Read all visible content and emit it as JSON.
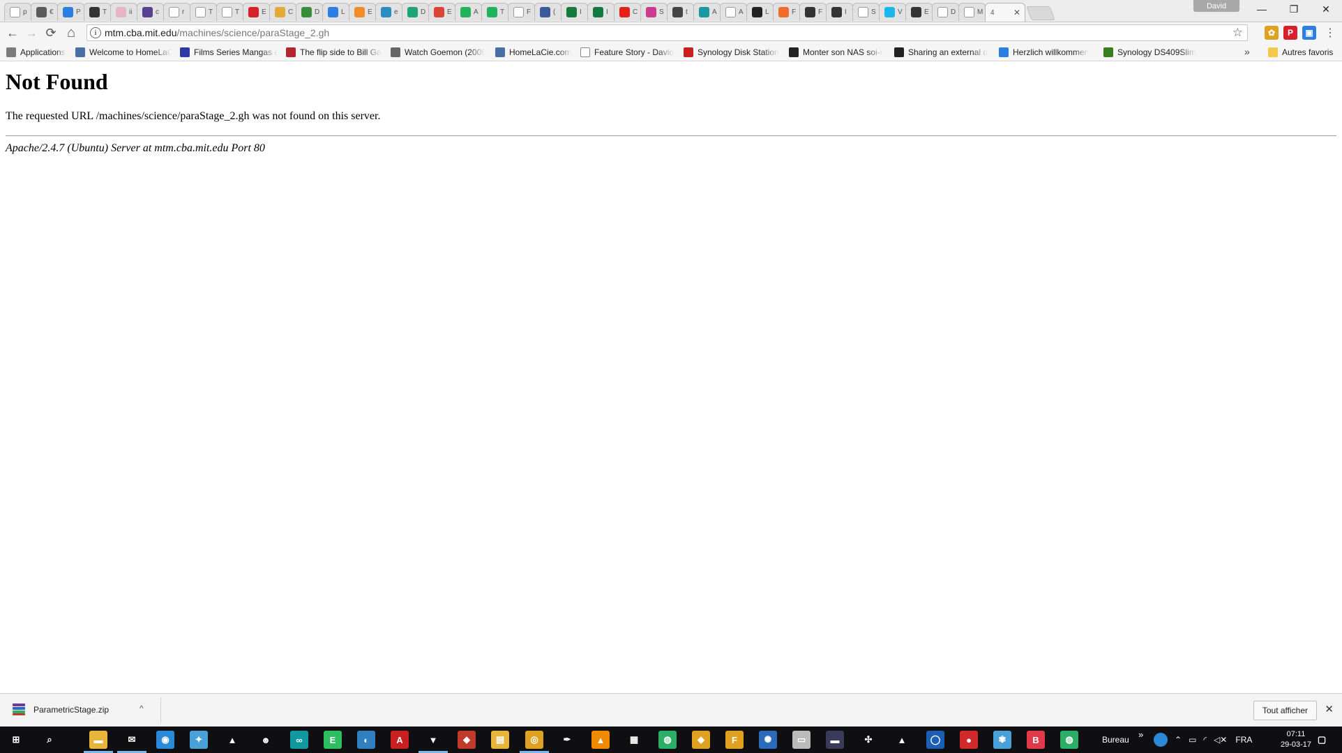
{
  "window": {
    "profile_name": "David",
    "controls": {
      "minimize": "—",
      "maximize": "❐",
      "close": "✕"
    }
  },
  "tabs": [
    {
      "icon": "google-icon",
      "letter": "p",
      "color": "#ffffff"
    },
    {
      "icon": "slack-icon",
      "letter": "€",
      "color": "#5b5b5b"
    },
    {
      "icon": "dropbox-icon",
      "letter": "P",
      "color": "#2b7fe0"
    },
    {
      "icon": "pin-icon",
      "letter": "T",
      "color": "#333333"
    },
    {
      "icon": "heart-icon",
      "letter": "ii",
      "color": "#e5b6c6"
    },
    {
      "icon": "grid-icon",
      "letter": "c",
      "color": "#5a3f8f"
    },
    {
      "icon": "google-icon",
      "letter": "r",
      "color": "#ffffff"
    },
    {
      "icon": "page-icon",
      "letter": "T",
      "color": "#ffffff"
    },
    {
      "icon": "page-icon",
      "letter": "T",
      "color": "#ffffff"
    },
    {
      "icon": "pinterest-icon",
      "letter": "E",
      "color": "#d6202a"
    },
    {
      "icon": "hands-icon",
      "letter": "C",
      "color": "#e5a93a"
    },
    {
      "icon": "shield-icon",
      "letter": "D",
      "color": "#3a8d3a"
    },
    {
      "icon": "globe-icon",
      "letter": "L",
      "color": "#2b7fe0"
    },
    {
      "icon": "bg-icon",
      "letter": "E",
      "color": "#f28c28"
    },
    {
      "icon": "wordpress-icon",
      "letter": "e",
      "color": "#2b8cc4"
    },
    {
      "icon": "drop-icon",
      "letter": "D",
      "color": "#1fa37a"
    },
    {
      "icon": "gmail-icon",
      "letter": "E",
      "color": "#db4437"
    },
    {
      "icon": "m-icon",
      "letter": "A",
      "color": "#20b25c"
    },
    {
      "icon": "m-icon",
      "letter": "T",
      "color": "#20b25c"
    },
    {
      "icon": "google-icon",
      "letter": "F",
      "color": "#ffffff"
    },
    {
      "icon": "facebook-icon",
      "letter": "(",
      "color": "#3b5998"
    },
    {
      "icon": "k-icon",
      "letter": "I",
      "color": "#157a3d"
    },
    {
      "icon": "k-icon",
      "letter": "I",
      "color": "#157a3d"
    },
    {
      "icon": "youtube-icon",
      "letter": "C",
      "color": "#e62117"
    },
    {
      "icon": "5x-icon",
      "letter": "S",
      "color": "#cc3b8f"
    },
    {
      "icon": "tools-icon",
      "letter": "t",
      "color": "#444444"
    },
    {
      "icon": "infinity-icon",
      "letter": "A",
      "color": "#1a9aa0"
    },
    {
      "icon": "page-icon",
      "letter": "A",
      "color": "#ffffff"
    },
    {
      "icon": "car-icon",
      "letter": "L",
      "color": "#222222"
    },
    {
      "icon": "e-circle-icon",
      "letter": "F",
      "color": "#f06b2d"
    },
    {
      "icon": "a-icon",
      "letter": "F",
      "color": "#333333"
    },
    {
      "icon": "dark-icon",
      "letter": "I",
      "color": "#333333"
    },
    {
      "icon": "page-icon",
      "letter": "S",
      "color": "#ffffff"
    },
    {
      "icon": "vimeo-icon",
      "letter": "V",
      "color": "#1ab7ea"
    },
    {
      "icon": "pattern-icon",
      "letter": "E",
      "color": "#333333"
    },
    {
      "icon": "page-icon",
      "letter": "D",
      "color": "#ffffff"
    },
    {
      "icon": "book-icon",
      "letter": "M",
      "color": "#ffffff"
    }
  ],
  "active_tab": {
    "title": "4",
    "close": "✕"
  },
  "toolbar": {
    "back": "←",
    "forward": "→",
    "reload": "⟳",
    "home": "⌂",
    "url_host": "mtm.cba.mit.edu",
    "url_path": "/machines/science/paraStage_2.gh",
    "info": "i",
    "star": "☆"
  },
  "extensions": [
    {
      "name": "extension-icon-1",
      "glyph": "✿",
      "color": "#e0a020"
    },
    {
      "name": "pinterest-extension-icon",
      "glyph": "P",
      "color": "#d6202a"
    },
    {
      "name": "extension-icon-3",
      "glyph": "▣",
      "color": "#2b7fe0"
    }
  ],
  "menu_glyph": "⋮",
  "bookmarks": [
    {
      "label": "Applications",
      "icon": "apps-grid-icon",
      "color": "#7a7a7a"
    },
    {
      "label": "Welcome to HomeLaC",
      "icon": "feather-icon",
      "color": "#4a6fa5"
    },
    {
      "label": "Films Series Mangas e",
      "icon": "c-icon",
      "color": "#2d3aa6"
    },
    {
      "label": "The flip side to Bill Ga",
      "icon": "nhl-icon",
      "color": "#b3262e"
    },
    {
      "label": "Watch Goemon (2009",
      "icon": "truck-icon",
      "color": "#666666"
    },
    {
      "label": "HomeLaCie.com",
      "icon": "feather-icon",
      "color": "#4a6fa5"
    },
    {
      "label": "Feature Story - David",
      "icon": "page-icon",
      "color": "#ffffff"
    },
    {
      "label": "Synology Disk Station",
      "icon": "synology-icon",
      "color": "#c8201f"
    },
    {
      "label": "Monter son NAS soi-r",
      "icon": "tw-icon",
      "color": "#222222"
    },
    {
      "label": "Sharing an external d",
      "icon": "x-icon",
      "color": "#222222"
    },
    {
      "label": "Herzlich willkommen",
      "icon": "hatch-icon",
      "color": "#2b7fe0"
    },
    {
      "label": "Synology DS409Slim",
      "icon": "star-badge-icon",
      "color": "#3a7d1f"
    }
  ],
  "bookmarks_overflow": "»",
  "other_bookmarks": "Autres favoris",
  "page": {
    "heading": "Not Found",
    "message": "The requested URL /machines/science/paraStage_2.gh was not found on this server.",
    "address": "Apache/2.4.7 (Ubuntu) Server at mtm.cba.mit.edu Port 80"
  },
  "download_bar": {
    "file_name": "ParametricStage.zip",
    "chevron": "^",
    "show_all": "Tout afficher",
    "close": "✕"
  },
  "taskbar": {
    "apps": [
      {
        "name": "start-icon",
        "glyph": "⊞",
        "color": "#0f0f12"
      },
      {
        "name": "search-icon",
        "glyph": "⌕",
        "color": "#0f0f12"
      },
      {
        "name": "file-explorer-icon",
        "glyph": "▬",
        "color": "#e8b43a"
      },
      {
        "name": "mail-icon",
        "glyph": "✉",
        "color": "#0f0f12"
      },
      {
        "name": "app-blue-circle-icon",
        "glyph": "◉",
        "color": "#2a8ad8"
      },
      {
        "name": "app-rocket-icon",
        "glyph": "✦",
        "color": "#4aa0d8"
      },
      {
        "name": "photos-icon",
        "glyph": "▲",
        "color": "#0f0f12"
      },
      {
        "name": "app-spaceman-icon",
        "glyph": "☻",
        "color": "#0f0f12"
      },
      {
        "name": "arduino-icon",
        "glyph": "∞",
        "color": "#12999f"
      },
      {
        "name": "evernote-icon",
        "glyph": "E",
        "color": "#2dbe60"
      },
      {
        "name": "app-fish-icon",
        "glyph": "◐",
        "color": "#2f7fc1"
      },
      {
        "name": "acrobat-icon",
        "glyph": "A",
        "color": "#c8201f"
      },
      {
        "name": "app-bird-icon",
        "glyph": "▼",
        "color": "#0f0f12"
      },
      {
        "name": "app-cube-icon",
        "glyph": "◆",
        "color": "#c0392b"
      },
      {
        "name": "app-document-icon",
        "glyph": "▤",
        "color": "#e8b43a"
      },
      {
        "name": "chrome-icon",
        "glyph": "◎",
        "color": "#e0a020"
      },
      {
        "name": "app-pen-icon",
        "glyph": "✒",
        "color": "#0f0f12"
      },
      {
        "name": "vlc-icon",
        "glyph": "▲",
        "color": "#f08a00"
      },
      {
        "name": "calculator-icon",
        "glyph": "▦",
        "color": "#0f0f12"
      },
      {
        "name": "app-green-globe-icon",
        "glyph": "◍",
        "color": "#2bae66"
      },
      {
        "name": "app-diamond-icon",
        "glyph": "◆",
        "color": "#e0a020"
      },
      {
        "name": "app-f-icon",
        "glyph": "F",
        "color": "#e0a020"
      },
      {
        "name": "app-wheel-icon",
        "glyph": "✺",
        "color": "#2a6ab8"
      },
      {
        "name": "app-card-icon",
        "glyph": "▭",
        "color": "#bbbbbb"
      },
      {
        "name": "app-keyboard-icon",
        "glyph": "▬",
        "color": "#3a3a5a"
      },
      {
        "name": "app-gamepad-icon",
        "glyph": "✣",
        "color": "#0f0f12"
      },
      {
        "name": "app-mountain-icon",
        "glyph": "▲",
        "color": "#0f0f12"
      },
      {
        "name": "app-ring-icon",
        "glyph": "◯",
        "color": "#1a5fb4"
      },
      {
        "name": "app-red-disc-icon",
        "glyph": "●",
        "color": "#d02a2a"
      },
      {
        "name": "app-flower-icon",
        "glyph": "✾",
        "color": "#4aa0d8"
      },
      {
        "name": "app-red-b-icon",
        "glyph": "B",
        "color": "#e03a4a"
      },
      {
        "name": "app-green-globe-2-icon",
        "glyph": "◍",
        "color": "#2bae66"
      }
    ],
    "desktop_label": "Bureau",
    "tray_overflow": "»",
    "language": "FRA",
    "time": "07:11",
    "date": "29-03-17"
  }
}
